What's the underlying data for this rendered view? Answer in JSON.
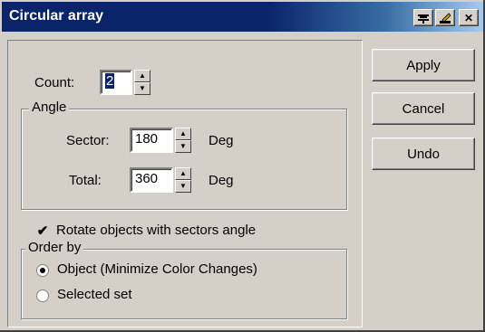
{
  "window": {
    "title": "Circular array"
  },
  "titlebar_buttons": {
    "pin_icon": "pin-icon",
    "edit_icon": "pencil-icon",
    "close": "✕"
  },
  "count": {
    "label": "Count:",
    "value": "2"
  },
  "angle_group": {
    "title": "Angle",
    "sector": {
      "label": "Sector:",
      "value": "180",
      "unit": "Deg"
    },
    "total": {
      "label": "Total:",
      "value": "360",
      "unit": "Deg"
    }
  },
  "rotate": {
    "label": "Rotate objects with sectors angle",
    "checked": true
  },
  "order_group": {
    "title": "Order by",
    "options": [
      {
        "label": "Object (Minimize Color Changes)",
        "selected": true
      },
      {
        "label": "Selected set",
        "selected": false
      }
    ]
  },
  "buttons": {
    "apply": "Apply",
    "cancel": "Cancel",
    "undo": "Undo"
  }
}
